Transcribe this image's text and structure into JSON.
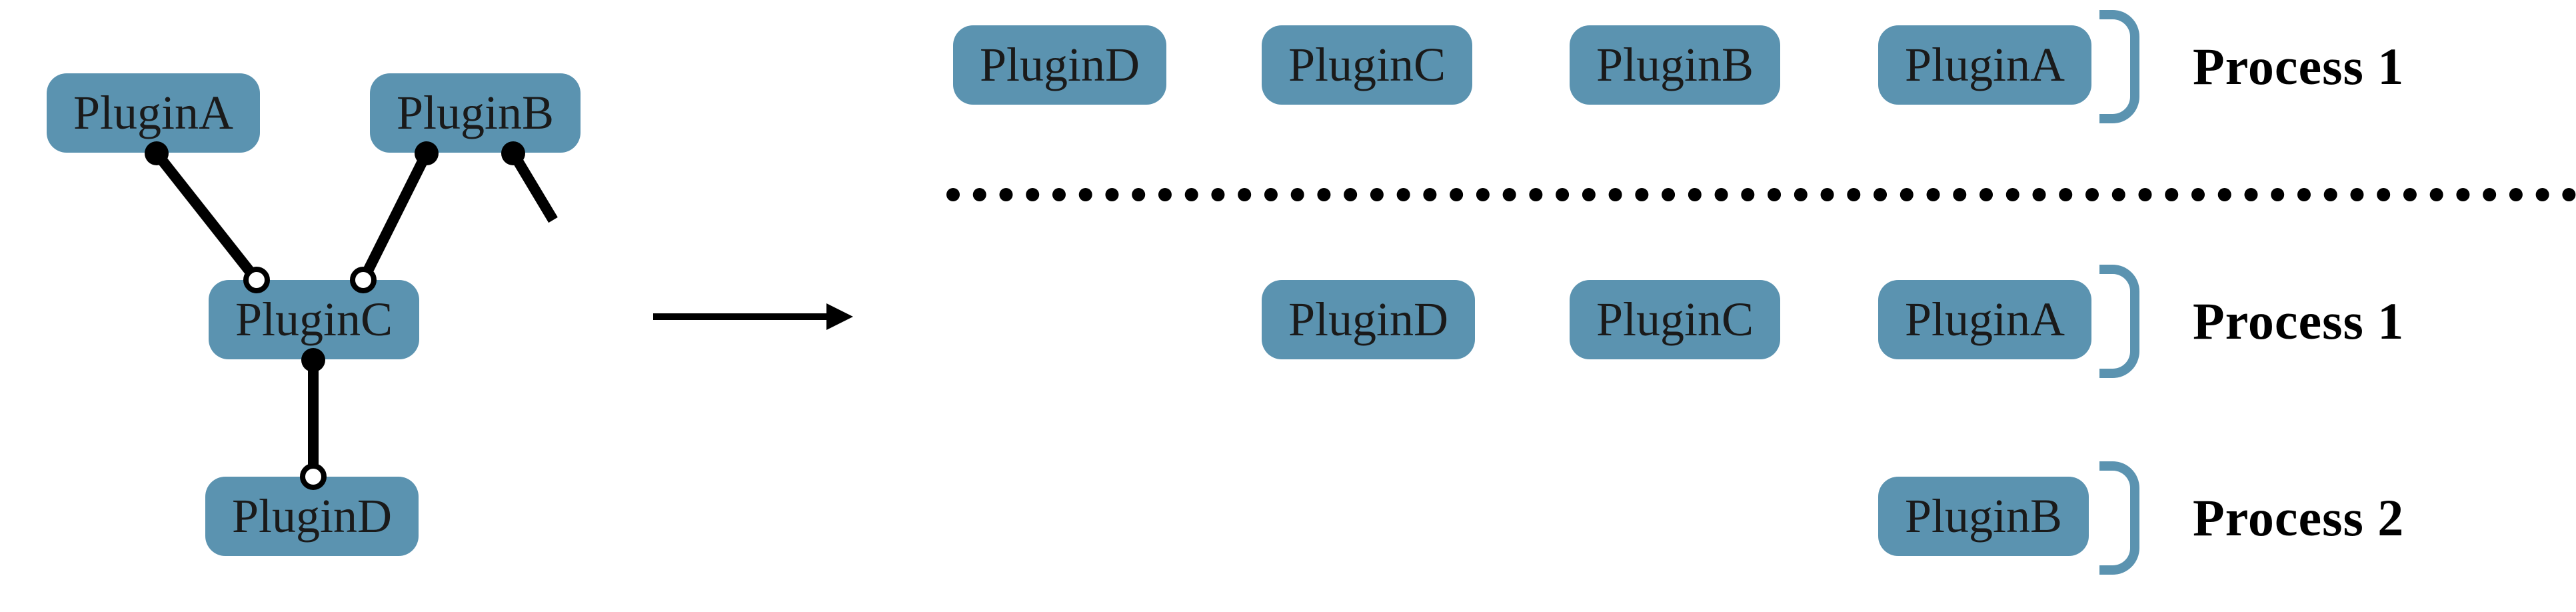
{
  "graph": {
    "nodes": {
      "a": "PluginA",
      "b": "PluginB",
      "c": "PluginC",
      "d": "PluginD"
    }
  },
  "topRow": {
    "items": [
      "PluginD",
      "PluginC",
      "PluginB",
      "PluginA"
    ],
    "label": "Process 1"
  },
  "middleRow": {
    "items": [
      "PluginD",
      "PluginC",
      "PluginA"
    ],
    "label": "Process 1"
  },
  "bottomRow": {
    "items": [
      "PluginB"
    ],
    "label": "Process 2"
  }
}
